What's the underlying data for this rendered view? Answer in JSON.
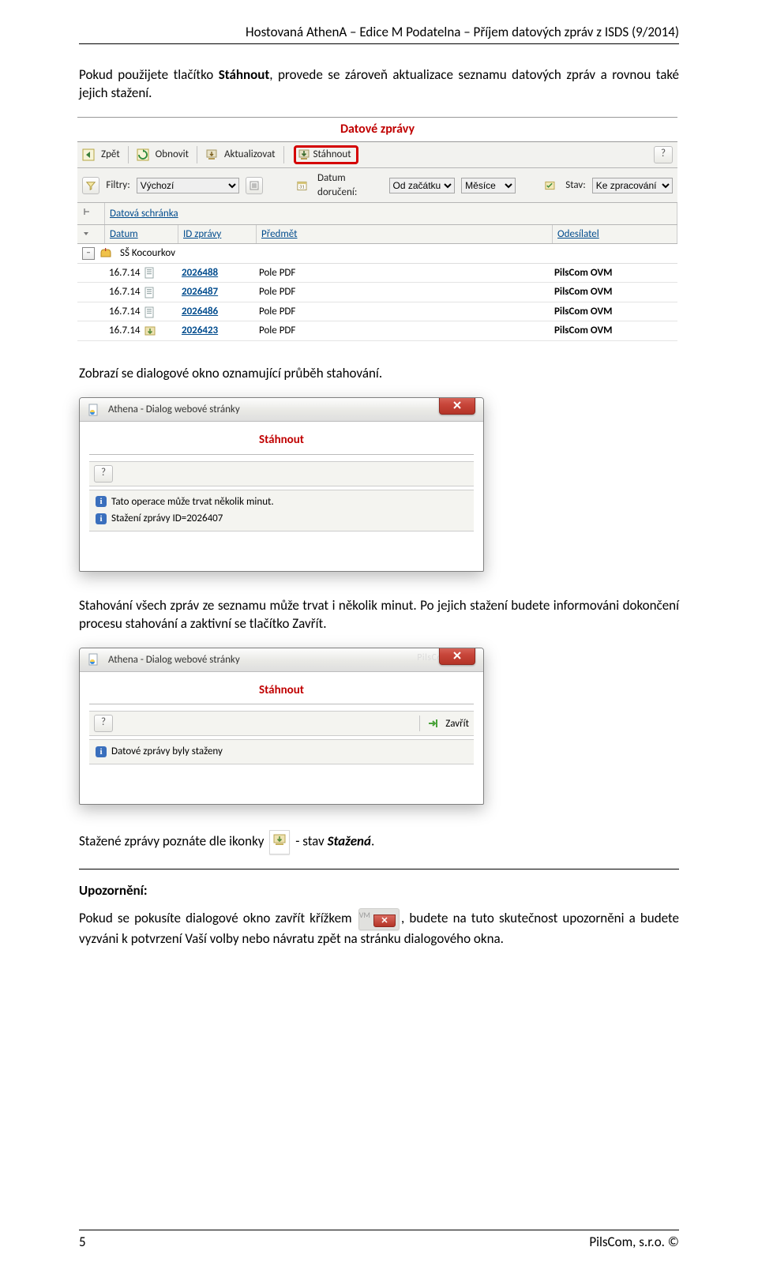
{
  "header": "Hostovaná AthenA – Edice M   Podatelna – Příjem datových zpráv z ISDS (9/2014)",
  "para1_a": "Pokud použijete tlačítko ",
  "para1_b": "Stáhnout",
  "para1_c": ", provede se zároveň aktualizace seznamu datových zpráv a rovnou také jejich stažení.",
  "fig1": {
    "title": "Datové zprávy",
    "toolbar": {
      "back": "Zpět",
      "refresh": "Obnovit",
      "update": "Aktualizovat",
      "download": "Stáhnout",
      "help": "?"
    },
    "filters": {
      "label": "Filtry:",
      "filtry_value": "Výchozí",
      "date_label": "Datum doručení:",
      "date_value": "Od začátku",
      "month_value": "Měsíce",
      "stav_label": "Stav:",
      "stav_value": "Ke zpracování"
    },
    "thead_main": "Datová schránka",
    "thead": {
      "datum": "Datum",
      "id": "ID zprávy",
      "predmet": "Předmět",
      "odesilatel": "Odesílatel"
    },
    "group": "SŠ Kocourkov",
    "rows": [
      {
        "date": "16.7.14",
        "id": "2026488",
        "subject": "Pole PDF",
        "sender": "PilsCom OVM"
      },
      {
        "date": "16.7.14",
        "id": "2026487",
        "subject": "Pole PDF",
        "sender": "PilsCom OVM"
      },
      {
        "date": "16.7.14",
        "id": "2026486",
        "subject": "Pole PDF",
        "sender": "PilsCom OVM"
      },
      {
        "date": "16.7.14",
        "id": "2026423",
        "subject": "Pole PDF",
        "sender": "PilsCom OVM"
      }
    ]
  },
  "para2": "Zobrazí se dialogové okno oznamující průběh stahování.",
  "dlg1": {
    "title": "Athena - Dialog webové stránky",
    "heading": "Stáhnout",
    "help": "?",
    "msg1": "Tato operace může trvat několik minut.",
    "msg2": "Stažení zprávy ID=2026407"
  },
  "para3": "Stahování všech zpráv ze seznamu může trvat i několik minut. Po jejich stažení budete informováni dokončení procesu stahování a zaktivní se tlačítko Zavřít.",
  "dlg2": {
    "title": "Athena - Dialog webové stránky",
    "heading": "Stáhnout",
    "help": "?",
    "close": "Zavřít",
    "msg1": "Datové zprávy byly staženy"
  },
  "para4_a": "Stažené zprávy poznáte dle ikonky ",
  "para4_b": "  - stav ",
  "para4_c": "Stažená",
  "para4_d": ".",
  "upozorneni_h": "Upozornění:",
  "upozorneni_a": "Pokud se pokusíte dialogové okno zavřít křížkem ",
  "upozorneni_b": ", budete na tuto skutečnost upozorněni a budete vyzváni k potvrzení Vaší volby nebo návratu zpět na stránku dialogového okna.",
  "footer": {
    "page": "5",
    "copyright": "PilsCom, s.r.o. ©"
  }
}
